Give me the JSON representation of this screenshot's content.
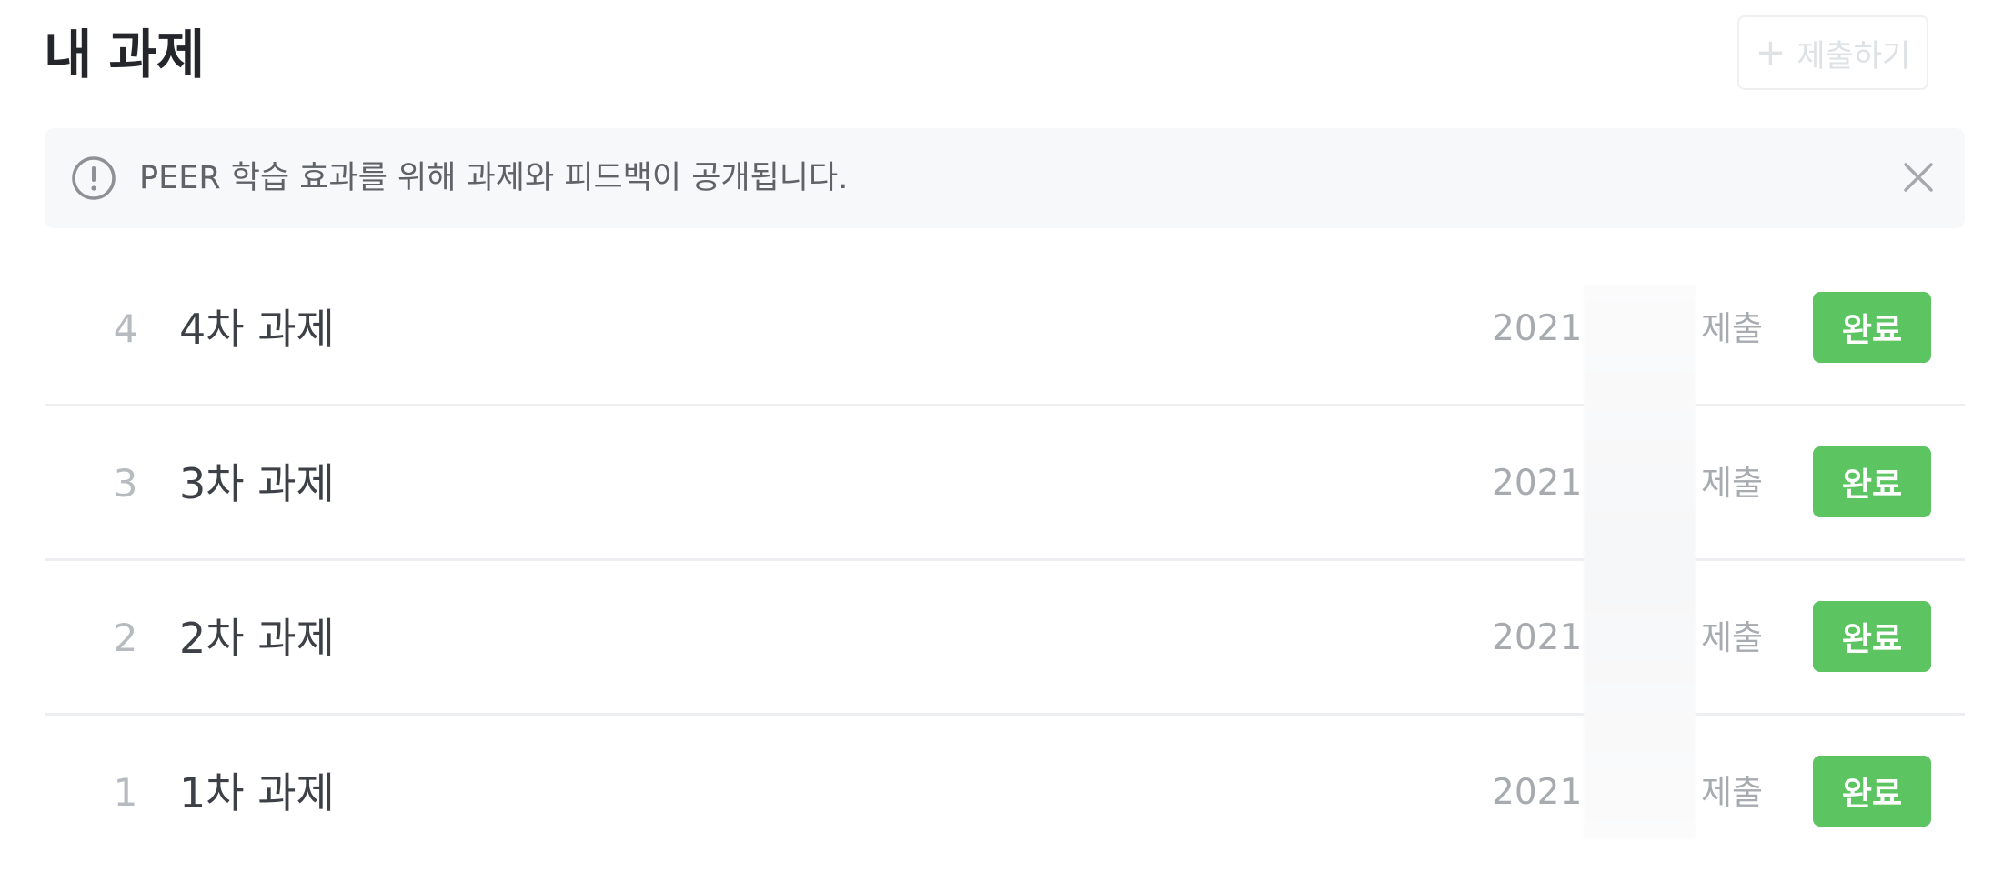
{
  "header": {
    "title": "내 과제",
    "submit_icon": "plus-icon",
    "submit_label": "제출하기"
  },
  "notice": {
    "icon": "info-circle-icon",
    "text": "PEER 학습 효과를 위해 과제와 피드백이 공개됩니다.",
    "close_icon": "close-icon"
  },
  "assignments": [
    {
      "number": "4",
      "title": "4차 과제",
      "date": "2021.",
      "submitted": "제출",
      "status": "완료"
    },
    {
      "number": "3",
      "title": "3차 과제",
      "date": "2021.",
      "submitted": "제출",
      "status": "완료"
    },
    {
      "number": "2",
      "title": "2차 과제",
      "date": "2021.",
      "submitted": "제출",
      "status": "완료"
    },
    {
      "number": "1",
      "title": "1차 과제",
      "date": "2021.",
      "submitted": "제출",
      "status": "완료"
    }
  ],
  "colors": {
    "status_badge": "#5cc461",
    "notice_background": "#f7f8fa",
    "divider": "#eceef1"
  }
}
